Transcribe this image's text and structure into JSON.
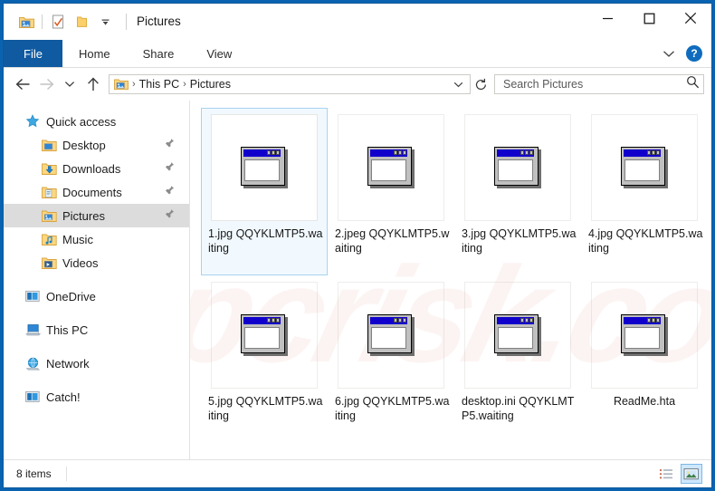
{
  "window": {
    "title": "Pictures",
    "quick_access": [
      {
        "name": "folder-pictures-icon",
        "label": "Pictures"
      },
      {
        "name": "properties-icon",
        "label": "Properties"
      },
      {
        "name": "new-folder-icon",
        "label": "New folder"
      },
      {
        "name": "customize-chevron-icon",
        "label": "Customize Quick Access Toolbar"
      }
    ],
    "controls": [
      {
        "name": "minimize-button",
        "label": "Minimize"
      },
      {
        "name": "maximize-button",
        "label": "Maximize"
      },
      {
        "name": "close-button",
        "label": "Close"
      }
    ]
  },
  "ribbon": {
    "tabs": [
      {
        "label": "File",
        "active": true
      },
      {
        "label": "Home",
        "active": false
      },
      {
        "label": "Share",
        "active": false
      },
      {
        "label": "View",
        "active": false
      }
    ],
    "expand_label": "Expand the Ribbon",
    "help_label": "?"
  },
  "address": {
    "back_label": "Back",
    "forward_label": "Forward",
    "recent_label": "Recent locations",
    "up_label": "Up",
    "breadcrumb": [
      "This PC",
      "Pictures"
    ],
    "separator": "›",
    "dropdown_label": "Previous locations",
    "refresh_label": "Refresh"
  },
  "search": {
    "placeholder": "Search Pictures",
    "value": "",
    "icon": "search-icon"
  },
  "sidebar": {
    "groups": [
      {
        "header": {
          "label": "Quick access",
          "icon": "star-icon"
        },
        "items": [
          {
            "label": "Desktop",
            "icon": "folder-desktop-icon",
            "pinned": true,
            "selected": false
          },
          {
            "label": "Downloads",
            "icon": "folder-downloads-icon",
            "pinned": true,
            "selected": false
          },
          {
            "label": "Documents",
            "icon": "folder-documents-icon",
            "pinned": true,
            "selected": false
          },
          {
            "label": "Pictures",
            "icon": "folder-pictures-icon",
            "pinned": true,
            "selected": true
          },
          {
            "label": "Music",
            "icon": "folder-music-icon",
            "pinned": false,
            "selected": false
          },
          {
            "label": "Videos",
            "icon": "folder-videos-icon",
            "pinned": false,
            "selected": false
          }
        ]
      },
      {
        "header": {
          "label": "OneDrive",
          "icon": "onedrive-icon"
        },
        "items": []
      },
      {
        "header": {
          "label": "This PC",
          "icon": "computer-icon"
        },
        "items": []
      },
      {
        "header": {
          "label": "Network",
          "icon": "network-icon"
        },
        "items": []
      },
      {
        "header": {
          "label": "Catch!",
          "icon": "drive-icon"
        },
        "items": []
      }
    ]
  },
  "files": [
    {
      "name": "1.jpg QQYKLMTP5.waiting",
      "icon": "generic-window-icon",
      "selected": true,
      "centered": false
    },
    {
      "name": "2.jpeg QQYKLMTP5.waiting",
      "icon": "generic-window-icon",
      "selected": false,
      "centered": false
    },
    {
      "name": "3.jpg QQYKLMTP5.waiting",
      "icon": "generic-window-icon",
      "selected": false,
      "centered": false
    },
    {
      "name": "4.jpg QQYKLMTP5.waiting",
      "icon": "generic-window-icon",
      "selected": false,
      "centered": false
    },
    {
      "name": "5.jpg QQYKLMTP5.waiting",
      "icon": "generic-window-icon",
      "selected": false,
      "centered": false
    },
    {
      "name": "6.jpg QQYKLMTP5.waiting",
      "icon": "generic-window-icon",
      "selected": false,
      "centered": false
    },
    {
      "name": "desktop.ini QQYKLMTP5.waiting",
      "icon": "generic-window-icon",
      "selected": false,
      "centered": false
    },
    {
      "name": "ReadMe.hta",
      "icon": "generic-window-icon",
      "selected": false,
      "centered": true
    }
  ],
  "status": {
    "items_count": "8 items",
    "views": [
      {
        "name": "details-view-button",
        "label": "Details view",
        "active": false
      },
      {
        "name": "large-icons-view-button",
        "label": "Large icons view",
        "active": true
      }
    ]
  },
  "watermark": {
    "text": "pcrisk.com"
  },
  "colors": {
    "accent": "#0f5aa0",
    "window_border": "#0f5a9b",
    "desktop": "#0a63b0",
    "selection": "#cde8ff",
    "nav_selected": "#dcdcdc",
    "icon_titlebar": "#1100cc"
  }
}
